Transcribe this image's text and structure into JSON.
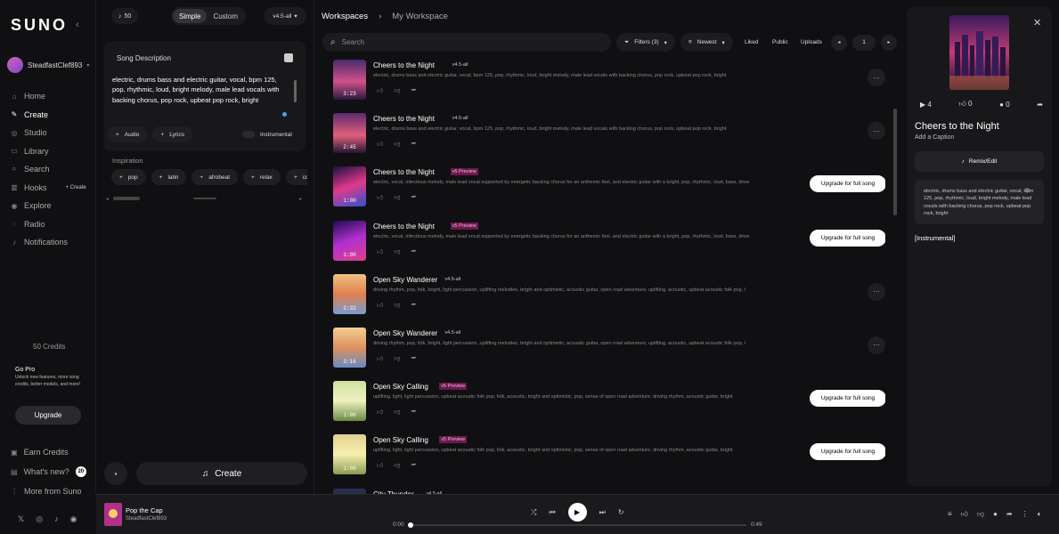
{
  "app": {
    "logo": "SUNO"
  },
  "sidebar": {
    "user_name": "SteadfastClef893",
    "nav": [
      {
        "label": "Home",
        "icon": "home-icon"
      },
      {
        "label": "Create",
        "icon": "create-icon"
      },
      {
        "label": "Studio",
        "icon": "studio-icon"
      },
      {
        "label": "Library",
        "icon": "library-icon"
      },
      {
        "label": "Search",
        "icon": "search-icon"
      },
      {
        "label": "Hooks",
        "icon": "hooks-icon",
        "extra": "+ Create"
      },
      {
        "label": "Explore",
        "icon": "explore-icon"
      },
      {
        "label": "Radio",
        "icon": "radio-icon"
      },
      {
        "label": "Notifications",
        "icon": "bell-icon"
      }
    ],
    "credits": "50 Credits",
    "gopro": {
      "title": "Go Pro",
      "desc": "Unlock new features, more song credits, better models, and more!",
      "button": "Upgrade"
    },
    "bottom": [
      {
        "label": "Earn Credits",
        "icon": "gift-icon"
      },
      {
        "label": "What's new?",
        "icon": "news-icon",
        "badge": "20"
      },
      {
        "label": "More from Suno",
        "icon": "more-icon"
      }
    ]
  },
  "create": {
    "credit_count": "50",
    "modes": [
      "Simple",
      "Custom"
    ],
    "active_mode": "Simple",
    "version": "v4.5-all",
    "desc_title": "Song Description",
    "desc_text": "electric, drums bass and electric guitar, vocal, bpm 125, pop, rhythmic, loud, bright melody, male lead vocals with backing chorus, pop rock, upbeat pop rock, bright",
    "chips": [
      "Audio",
      "Lyrics"
    ],
    "instrumental": "Instrumental",
    "inspiration_label": "Inspiration",
    "inspiration": [
      "pop",
      "latin",
      "afrobeat",
      "relax",
      "country"
    ],
    "create_button": "Create"
  },
  "main": {
    "breadcrumb": [
      "Workspaces",
      "My Workspace"
    ],
    "search_placeholder": "Search",
    "filters": "Filters (3)",
    "sort": "Newest",
    "tabs": [
      "Liked",
      "Public",
      "Uploads"
    ],
    "page": "1",
    "upgrade_label": "Upgrade for full song",
    "songs": [
      {
        "title": "Cheers to the Night",
        "version": "v4.5-all",
        "preview": false,
        "duration": "3:23",
        "desc": "electric, drums bass and electric guitar, vocal, bpm 125, pop, rhythmic, loud, bright melody, male lead vocals with backing chorus, pop rock, upbeat pop rock, bright",
        "thumb": "city"
      },
      {
        "title": "Cheers to the Night",
        "version": "v4.5-all",
        "preview": false,
        "duration": "2:45",
        "desc": "electric, drums bass and electric guitar, vocal, bpm 125, pop, rhythmic, loud, bright melody, male lead vocals with backing chorus, pop rock, upbeat pop rock, bright",
        "thumb": "city2"
      },
      {
        "title": "Cheers to the Night",
        "version": "v5 Preview",
        "preview": true,
        "duration": "1:00",
        "desc": "electric, vocal, infectious melody, male lead vocal supported by energetic backing chorus for an anthemic feel, and electric guitar with a bright, pop, rhythmic, loud, bass, drive",
        "thumb": "neon"
      },
      {
        "title": "Cheers to the Night",
        "version": "v5 Preview",
        "preview": true,
        "duration": "1:00",
        "desc": "electric, vocal, infectious melody, male lead vocal supported by energetic backing chorus for an anthemic feel, and electric guitar with a bright, pop, rhythmic, loud, bass, drive",
        "thumb": "neon2"
      },
      {
        "title": "Open Sky Wanderer",
        "version": "v4.5-all",
        "preview": false,
        "duration": "2:32",
        "desc": "driving rhythm, pop, folk, bright, light percussion, uplifting melodies, bright and optimistic, acoustic guitar, open road adventure, uplifting, acoustic, upbeat acoustic folk pop, l",
        "thumb": "balloon"
      },
      {
        "title": "Open Sky Wanderer",
        "version": "v4.5-all",
        "preview": false,
        "duration": "3:16",
        "desc": "driving rhythm, pop, folk, bright, light percussion, uplifting melodies, bright and optimistic, acoustic guitar, open road adventure, uplifting, acoustic, upbeat acoustic folk pop, l",
        "thumb": "balloon2"
      },
      {
        "title": "Open Sky Calling",
        "version": "v5 Preview",
        "preview": true,
        "duration": "1:00",
        "desc": "uplifting, light, light percussion, upbeat acoustic folk pop, folk, acoustic, bright and optimistic, pop, sense of open road adventure, driving rhythm, acoustic guitar, bright",
        "thumb": "road"
      },
      {
        "title": "Open Sky Calling",
        "version": "v5 Preview",
        "preview": true,
        "duration": "1:00",
        "desc": "uplifting, light, light percussion, upbeat acoustic folk pop, folk, acoustic, bright and optimistic, pop, sense of open road adventure, driving rhythm, acoustic guitar, bright",
        "thumb": "road2"
      },
      {
        "title": "City Thunder",
        "version": "v4.5-all",
        "preview": false,
        "duration": "",
        "desc": "",
        "thumb": "dark"
      }
    ]
  },
  "detail": {
    "plays": "4",
    "likes": "0",
    "comments": "0",
    "title": "Cheers to the Night",
    "caption": "Add a Caption",
    "remix": "Remix/Edit",
    "desc": "electric, drums bass and electric guitar, vocal, bpm 125, pop, rhythmic, loud, bright melody, male lead vocals with backing chorus, pop rock, upbeat pop rock, bright",
    "lyrics": "[Instrumental]"
  },
  "player": {
    "title": "Pop the Cap",
    "artist": "SteadfastClef893",
    "current": "0:00",
    "total": "0:49",
    "progress": 0
  }
}
